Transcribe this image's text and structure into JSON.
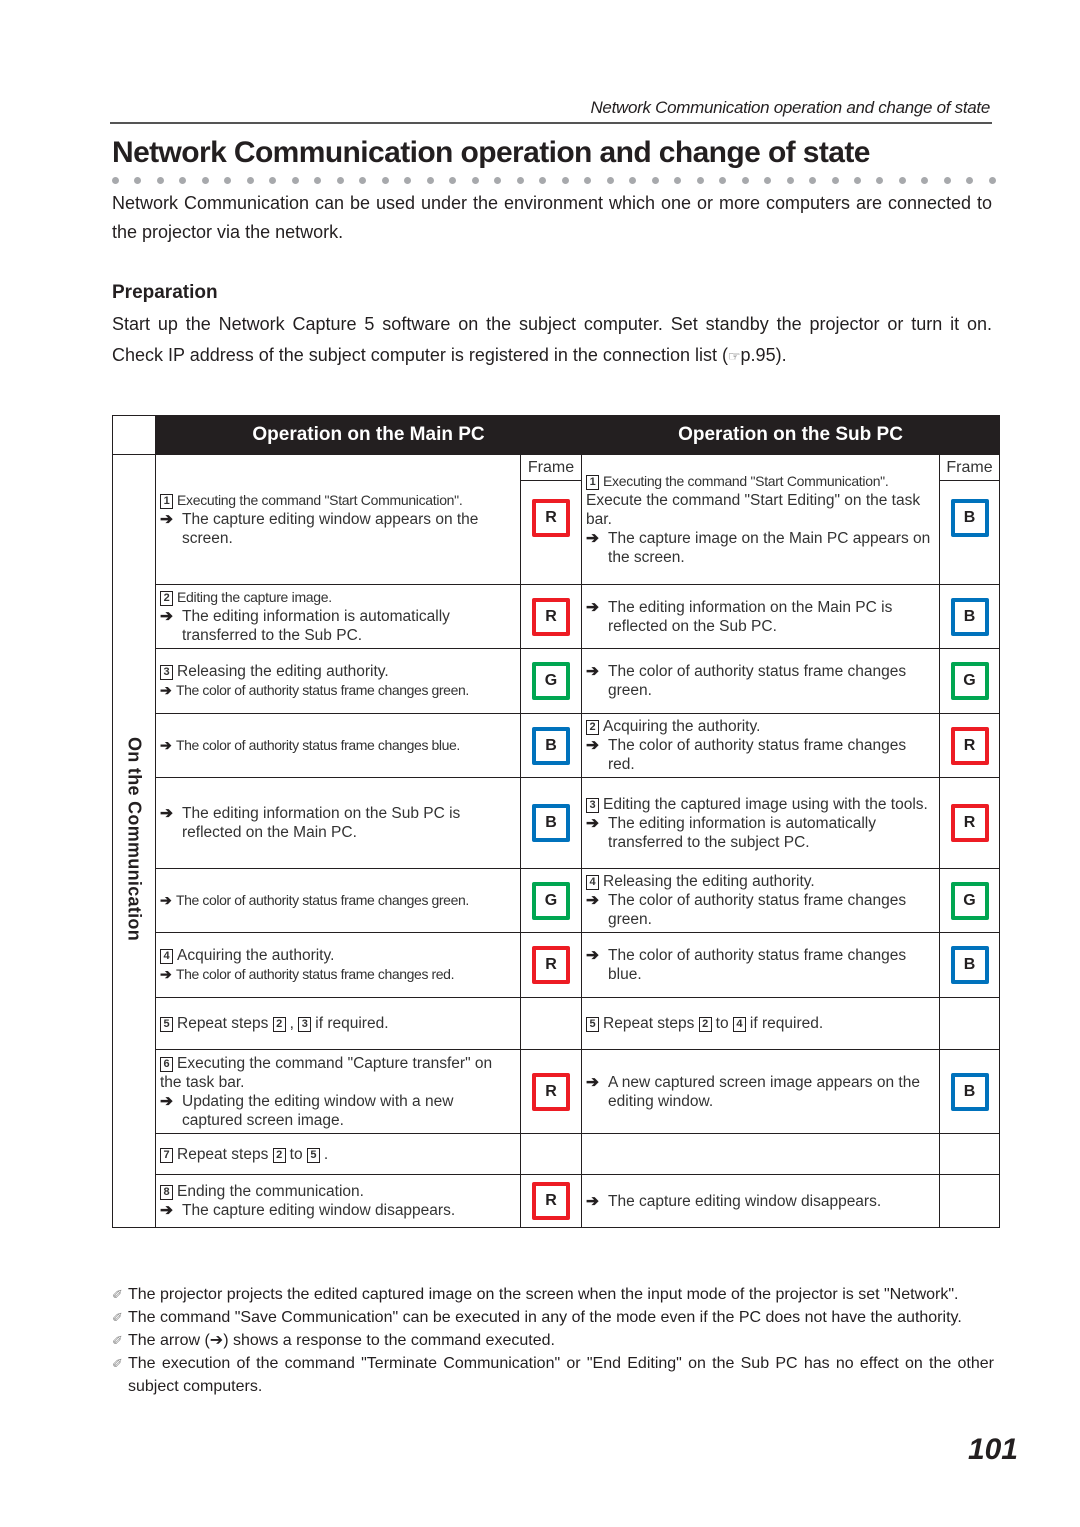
{
  "running_head": "Network Communication operation and change of state",
  "title": "Network Communication operation and change of state",
  "intro": "Network Communication can be used under the environment which one or more computers are connected to the projector via the network.",
  "preparation": {
    "heading": "Preparation",
    "text": "Start up the Network Capture 5 software on the subject computer. Set standby the projector or turn it on. Check IP address of the subject computer is registered in the connection list (",
    "ref_icon": "☞",
    "ref_text": "p.95)."
  },
  "table": {
    "header_main": "Operation on the Main PC",
    "header_sub": "Operation on the Sub PC",
    "frame_label": "Frame",
    "side_label": "On the Communication",
    "arrow": "➔",
    "rows": [
      {
        "main_step_num": "1",
        "main_step": "Executing the command \"Start Communication\".",
        "main_resp": "The capture editing window appears on the screen.",
        "main_frame": "R",
        "sub_step_num": "1",
        "sub_step": "Executing the command \"Start Communication\".",
        "sub_extra": "Execute the command \"Start Editing\" on the task bar.",
        "sub_resp": "The capture image on the Main PC appears on the screen.",
        "sub_frame": "B"
      },
      {
        "main_step_num": "2",
        "main_step": "Editing the capture image.",
        "main_resp": "The editing information is automatically transferred to the Sub PC.",
        "main_frame": "R",
        "sub_resp": "The editing information on the Main PC is reflected on the Sub PC.",
        "sub_frame": "B"
      },
      {
        "main_step_num": "3",
        "main_step": "Releasing the editing authority.",
        "main_resp": "The color of authority status frame changes green.",
        "main_frame": "G",
        "sub_resp": "The color of authority status frame changes green.",
        "sub_frame": "G"
      },
      {
        "main_resp": "The color of authority status frame changes blue.",
        "main_frame": "B",
        "sub_step_num": "2",
        "sub_step": "Acquiring the authority.",
        "sub_resp": "The color of authority status frame changes red.",
        "sub_frame": "R"
      },
      {
        "main_resp": "The editing information on the Sub PC is reflected on the Main PC.",
        "main_frame": "B",
        "sub_step_num": "3",
        "sub_step": "Editing the captured image using with the tools.",
        "sub_resp": "The editing information is automatically transferred to the subject PC.",
        "sub_frame": "R"
      },
      {
        "main_resp": "The color of authority status frame changes green.",
        "main_frame": "G",
        "sub_step_num": "4",
        "sub_step": "Releasing the editing authority.",
        "sub_resp": "The color of authority status frame changes green.",
        "sub_frame": "G"
      },
      {
        "main_step_num": "4",
        "main_step": "Acquiring the authority.",
        "main_resp": "The color of authority status frame changes red.",
        "main_frame": "R",
        "sub_resp": "The color of authority status frame changes blue.",
        "sub_frame": "B"
      },
      {
        "main_step_num": "5",
        "main_step_pre": "Repeat steps",
        "main_ref1": "2",
        "main_sep": ",",
        "main_ref2": "3",
        "main_step_post": "if required.",
        "sub_step_num": "5",
        "sub_step_pre": "Repeat steps",
        "sub_ref1": "2",
        "sub_sep": "to",
        "sub_ref2": "4",
        "sub_step_post": "if required."
      },
      {
        "main_step_num": "6",
        "main_step": "Executing the command \"Capture transfer\" on the task bar.",
        "main_resp": "Updating the editing window with a new captured screen image.",
        "main_frame": "R",
        "sub_resp": "A new captured screen image appears on the editing window.",
        "sub_frame": "B"
      },
      {
        "main_step_num": "7",
        "main_step_pre": "Repeat steps",
        "main_ref1": "2",
        "main_sep": "to",
        "main_ref2": "5",
        "main_step_post": "."
      },
      {
        "main_step_num": "8",
        "main_step": "Ending the communication.",
        "main_resp": "The capture editing window disappears.",
        "main_frame": "R",
        "sub_resp": "The capture editing window disappears."
      }
    ]
  },
  "notes_icon": "pencil-note",
  "notes": [
    "The projector projects the edited captured image on the screen when the input mode of the projector is set \"Network\".",
    "The command \"Save Communication\" can be executed in any of the mode even if the PC does not have the authority.",
    "The arrow (➔) shows a response to the command executed.",
    "The execution of the command \"Terminate Communication\" or \"End Editing\" on the Sub PC has no effect on the other subject computers."
  ],
  "page_number": "101",
  "colors": {
    "red": "#ed1c24",
    "green": "#00a651",
    "blue": "#0072bc",
    "header_bg": "#231f20"
  }
}
